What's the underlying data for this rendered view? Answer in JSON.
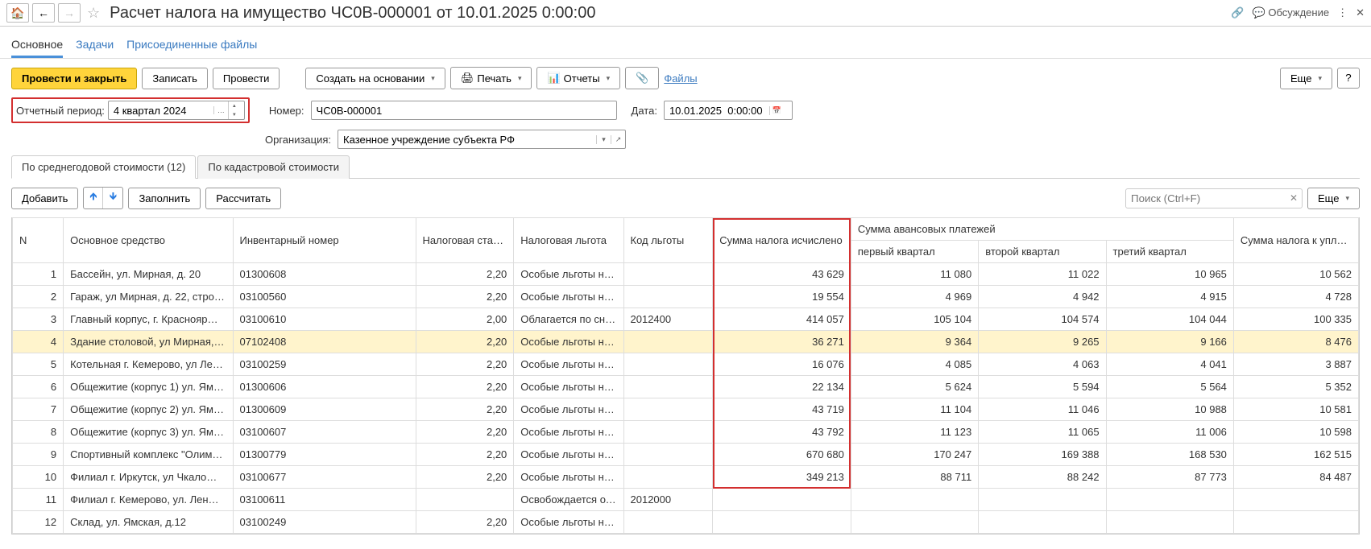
{
  "header": {
    "title": "Расчет налога на имущество ЧС0В-000001 от 10.01.2025 0:00:00",
    "discussion": "Обсуждение"
  },
  "mainTabs": {
    "main": "Основное",
    "tasks": "Задачи",
    "files": "Присоединенные файлы"
  },
  "buttons": {
    "postClose": "Провести и закрыть",
    "save": "Записать",
    "post": "Провести",
    "createBased": "Создать на основании",
    "print": "Печать",
    "reports": "Отчеты",
    "filesLink": "Файлы",
    "more": "Еще",
    "add": "Добавить",
    "fill": "Заполнить",
    "calc": "Рассчитать"
  },
  "form": {
    "periodLabel": "Отчетный период:",
    "periodValue": "4 квартал 2024",
    "numberLabel": "Номер:",
    "numberValue": "ЧС0В-000001",
    "dateLabel": "Дата:",
    "dateValue": "10.01.2025  0:00:00",
    "orgLabel": "Организация:",
    "orgValue": "Казенное учреждение субъекта РФ"
  },
  "subTabs": {
    "byAvg": "По среднегодовой стоимости (12)",
    "byCad": "По кадастровой стоимости"
  },
  "searchPlaceholder": "Поиск (Ctrl+F)",
  "tableHeaders": {
    "n": "N",
    "asset": "Основное средство",
    "inv": "Инвентарный номер",
    "rate": "Налоговая ставка",
    "benefit": "Налоговая льгота",
    "code": "Код льготы",
    "taxSum": "Сумма налога исчислено",
    "advSum": "Сумма авансовых платежей",
    "q1": "первый квартал",
    "q2": "второй квартал",
    "q3": "третий квартал",
    "pay": "Сумма налога к уплате"
  },
  "rows": [
    {
      "n": "1",
      "asset": "Бассейн, ул. Мирная, д. 20",
      "inv": "01300608",
      "rate": "2,20",
      "benefit": "Особые льготы не…",
      "code": "",
      "sum": "43 629",
      "q1": "11 080",
      "q2": "11 022",
      "q3": "10 965",
      "pay": "10 562"
    },
    {
      "n": "2",
      "asset": "Гараж, ул Мирная, д. 22, стро…",
      "inv": "03100560",
      "rate": "2,20",
      "benefit": "Особые льготы не…",
      "code": "",
      "sum": "19 554",
      "q1": "4 969",
      "q2": "4 942",
      "q3": "4 915",
      "pay": "4 728"
    },
    {
      "n": "3",
      "asset": "Главный корпус, г. Краснояр…",
      "inv": "03100610",
      "rate": "2,00",
      "benefit": "Облагается по сни…",
      "code": "2012400",
      "sum": "414 057",
      "q1": "105 104",
      "q2": "104 574",
      "q3": "104 044",
      "pay": "100 335"
    },
    {
      "n": "4",
      "asset": "Здание столовой, ул Мирная,…",
      "inv": "07102408",
      "rate": "2,20",
      "benefit": "Особые льготы не…",
      "code": "",
      "sum": "36 271",
      "q1": "9 364",
      "q2": "9 265",
      "q3": "9 166",
      "pay": "8 476",
      "selected": true
    },
    {
      "n": "5",
      "asset": "Котельная г. Кемерово, ул Ле…",
      "inv": "03100259",
      "rate": "2,20",
      "benefit": "Особые льготы не…",
      "code": "",
      "sum": "16 076",
      "q1": "4 085",
      "q2": "4 063",
      "q3": "4 041",
      "pay": "3 887"
    },
    {
      "n": "6",
      "asset": "Общежитие (корпус 1) ул. Ям…",
      "inv": "01300606",
      "rate": "2,20",
      "benefit": "Особые льготы не…",
      "code": "",
      "sum": "22 134",
      "q1": "5 624",
      "q2": "5 594",
      "q3": "5 564",
      "pay": "5 352"
    },
    {
      "n": "7",
      "asset": "Общежитие (корпус 2) ул. Ям…",
      "inv": "01300609",
      "rate": "2,20",
      "benefit": "Особые льготы не…",
      "code": "",
      "sum": "43 719",
      "q1": "11 104",
      "q2": "11 046",
      "q3": "10 988",
      "pay": "10 581"
    },
    {
      "n": "8",
      "asset": "Общежитие (корпус 3) ул. Ям…",
      "inv": "03100607",
      "rate": "2,20",
      "benefit": "Особые льготы не…",
      "code": "",
      "sum": "43 792",
      "q1": "11 123",
      "q2": "11 065",
      "q3": "11 006",
      "pay": "10 598"
    },
    {
      "n": "9",
      "asset": "Спортивный комплекс \"Олимп\"…",
      "inv": "01300779",
      "rate": "2,20",
      "benefit": "Особые льготы не…",
      "code": "",
      "sum": "670 680",
      "q1": "170 247",
      "q2": "169 388",
      "q3": "168 530",
      "pay": "162 515"
    },
    {
      "n": "10",
      "asset": "Филиал г. Иркутск, ул Чкало…",
      "inv": "03100677",
      "rate": "2,20",
      "benefit": "Особые льготы не…",
      "code": "",
      "sum": "349 213",
      "q1": "88 711",
      "q2": "88 242",
      "q3": "87 773",
      "pay": "84 487"
    },
    {
      "n": "11",
      "asset": "Филиал г. Кемерово, ул. Лен…",
      "inv": "03100611",
      "rate": "",
      "benefit": "Освобождается от…",
      "code": "2012000",
      "sum": "",
      "q1": "",
      "q2": "",
      "q3": "",
      "pay": ""
    },
    {
      "n": "12",
      "asset": "Склад, ул. Ямская, д.12",
      "inv": "03100249",
      "rate": "2,20",
      "benefit": "Особые льготы не…",
      "code": "",
      "sum": "",
      "q1": "",
      "q2": "",
      "q3": "",
      "pay": ""
    }
  ]
}
